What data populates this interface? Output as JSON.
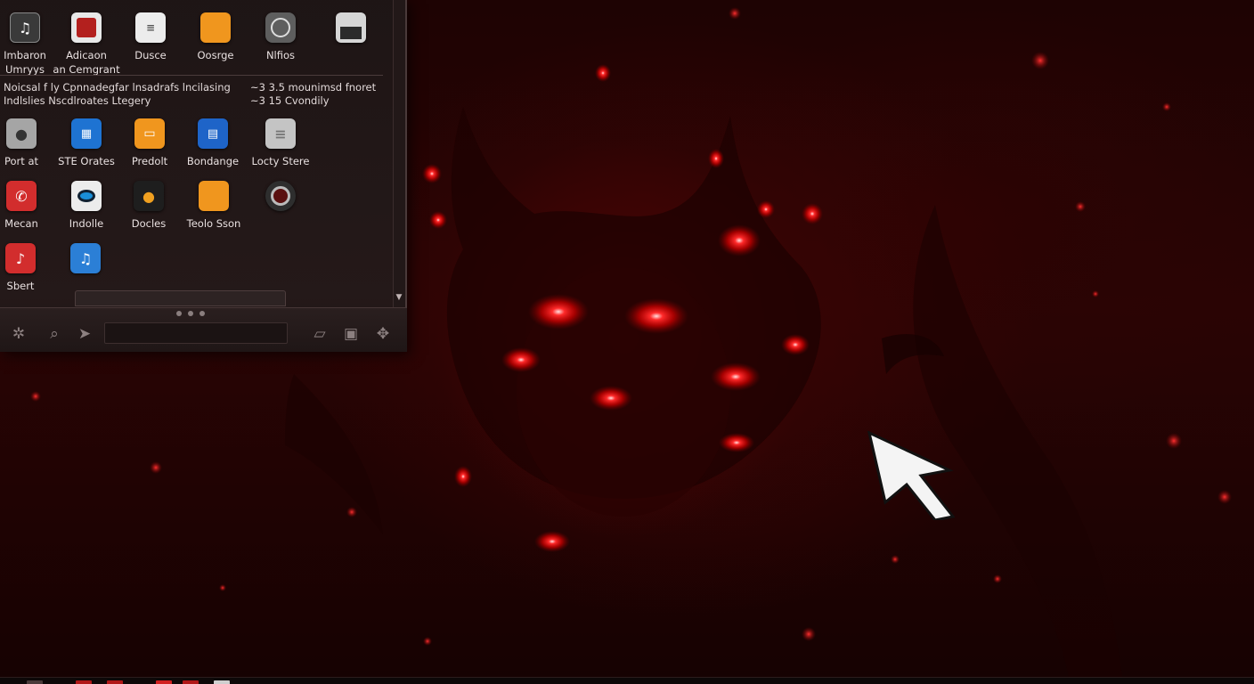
{
  "launcher": {
    "top_apps": [
      {
        "name": "Imbaron Umryys",
        "line1": "Imbaron",
        "line2": "Umryys",
        "icon": "music-icon",
        "color": "#3a3a3a"
      },
      {
        "name": "Adicaon an Cemgrant",
        "line1": "Adicaon",
        "line2": "an Cemgrant",
        "icon": "media-player-icon",
        "color": "#b3201e"
      },
      {
        "name": "Dusce",
        "line1": "Dusce",
        "line2": "",
        "icon": "document-icon",
        "color": "#e6e6e6"
      },
      {
        "name": "Oosrge",
        "line1": "Oosrge",
        "line2": "",
        "icon": "folder-icon",
        "color": "#f0961e"
      },
      {
        "name": "Nlfios",
        "line1": "Nlfios",
        "line2": "",
        "icon": "clock-icon",
        "color": "#5e5e5e"
      },
      {
        "name": "",
        "line1": "",
        "line2": "",
        "icon": "file-icon",
        "color": "#cfcfcf"
      }
    ],
    "info": {
      "left_line1": "Noicsal f ly Cpnnadegfar lnsadrafs lncilasing",
      "left_line2": "Indlslies    Nscdlroates    Ltegery",
      "right_line1": "~3 3.5 mounimsd fnoret",
      "right_line2": "~3 15 Cvondily"
    },
    "grid_apps": [
      {
        "label": "Port at",
        "icon": "user-icon",
        "color": "#9a9a9a"
      },
      {
        "label": "STE Orates",
        "icon": "calendar-icon",
        "color": "#1e73d2"
      },
      {
        "label": "Predolt",
        "icon": "ticket-icon",
        "color": "#f0961e"
      },
      {
        "label": "Bondange",
        "icon": "grid-app-icon",
        "color": "#1e64c8"
      },
      {
        "label": "Locty Stere",
        "icon": "notes-icon",
        "color": "#bdbdbd"
      },
      {
        "label": "Mecan",
        "icon": "phone-icon",
        "color": "#d22d2d"
      },
      {
        "label": "Indolle",
        "icon": "eye-icon",
        "color": "#e8e8e8"
      },
      {
        "label": "Docles",
        "icon": "badge-icon",
        "color": "#2a2a2a"
      },
      {
        "label": "Teolo Sson",
        "icon": "folder-icon",
        "color": "#f0961e"
      },
      {
        "label": "",
        "icon": "camera-icon",
        "color": "#3a3a3a"
      },
      {
        "label": "Sbert",
        "icon": "music-note-icon",
        "color": "#d22d2d"
      },
      {
        "label": "",
        "icon": "music-app-icon",
        "color": "#2b7fd6"
      }
    ]
  },
  "accent": "#e01010"
}
